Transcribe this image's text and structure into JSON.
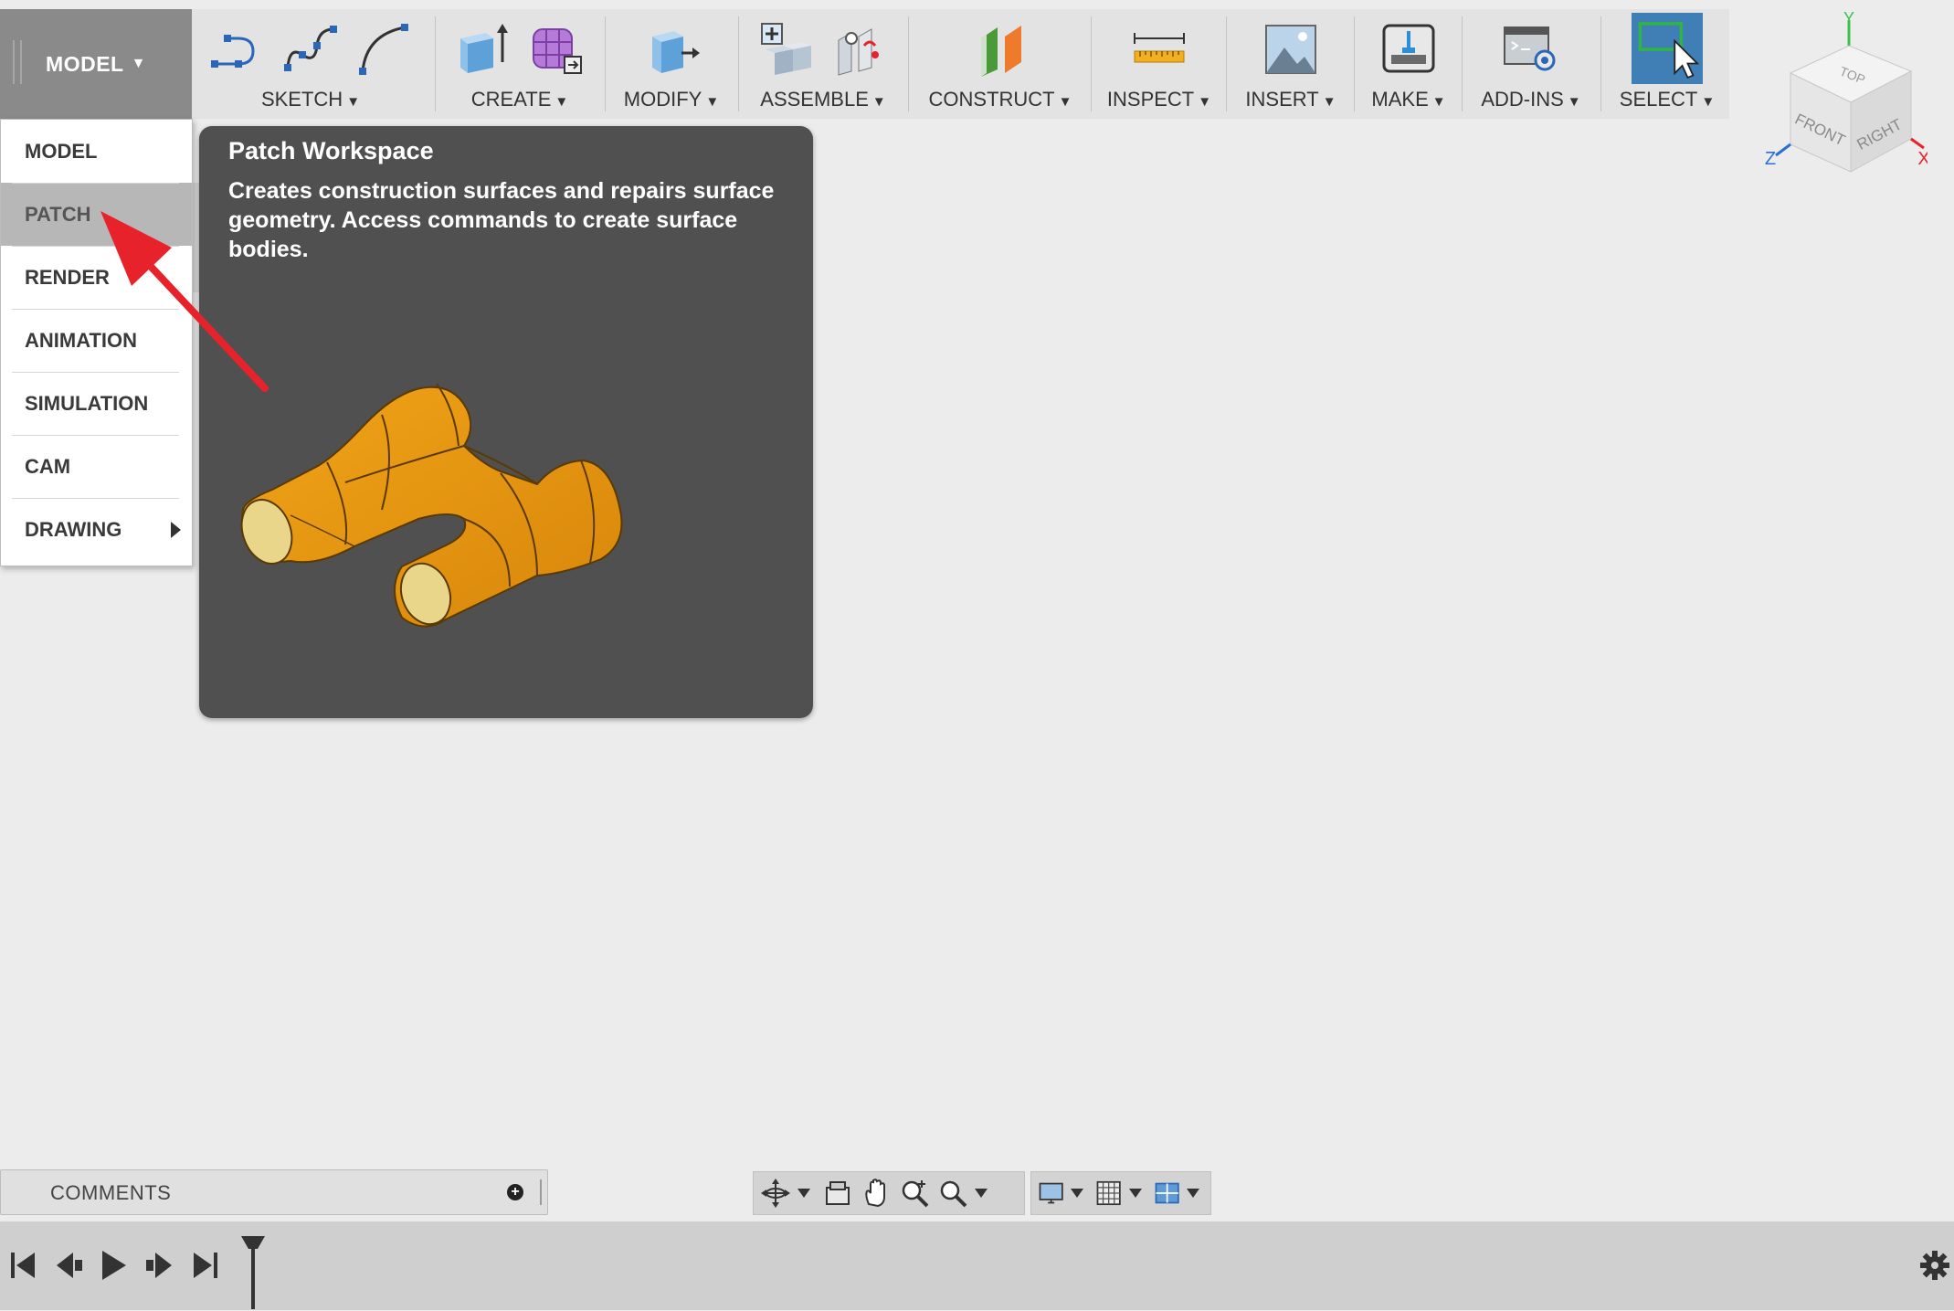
{
  "toolbar": {
    "workspace_label": "MODEL",
    "groups": [
      {
        "label": "SKETCH"
      },
      {
        "label": "CREATE"
      },
      {
        "label": "MODIFY"
      },
      {
        "label": "ASSEMBLE"
      },
      {
        "label": "CONSTRUCT"
      },
      {
        "label": "INSPECT"
      },
      {
        "label": "INSERT"
      },
      {
        "label": "MAKE"
      },
      {
        "label": "ADD-INS"
      },
      {
        "label": "SELECT"
      }
    ]
  },
  "viewcube": {
    "faces": {
      "top": "TOP",
      "front": "FRONT",
      "right": "RIGHT"
    },
    "axes": {
      "x": "X",
      "y": "Y",
      "z": "Z"
    }
  },
  "workspace_menu": {
    "items": [
      {
        "label": "MODEL"
      },
      {
        "label": "PATCH",
        "state": "hover"
      },
      {
        "label": "RENDER"
      },
      {
        "label": "ANIMATION"
      },
      {
        "label": "SIMULATION"
      },
      {
        "label": "CAM"
      },
      {
        "label": "DRAWING",
        "has_submenu": true
      }
    ]
  },
  "tooltip": {
    "title": "Patch Workspace",
    "description": "Creates construction surfaces and repairs surface geometry. Access commands to create surface bodies."
  },
  "comments": {
    "label": "COMMENTS"
  },
  "colors": {
    "accent_red": "#e8222a",
    "patch_orange": "#e89b12",
    "select_blue": "#3f7fb5",
    "tooltip_bg": "#505050"
  }
}
